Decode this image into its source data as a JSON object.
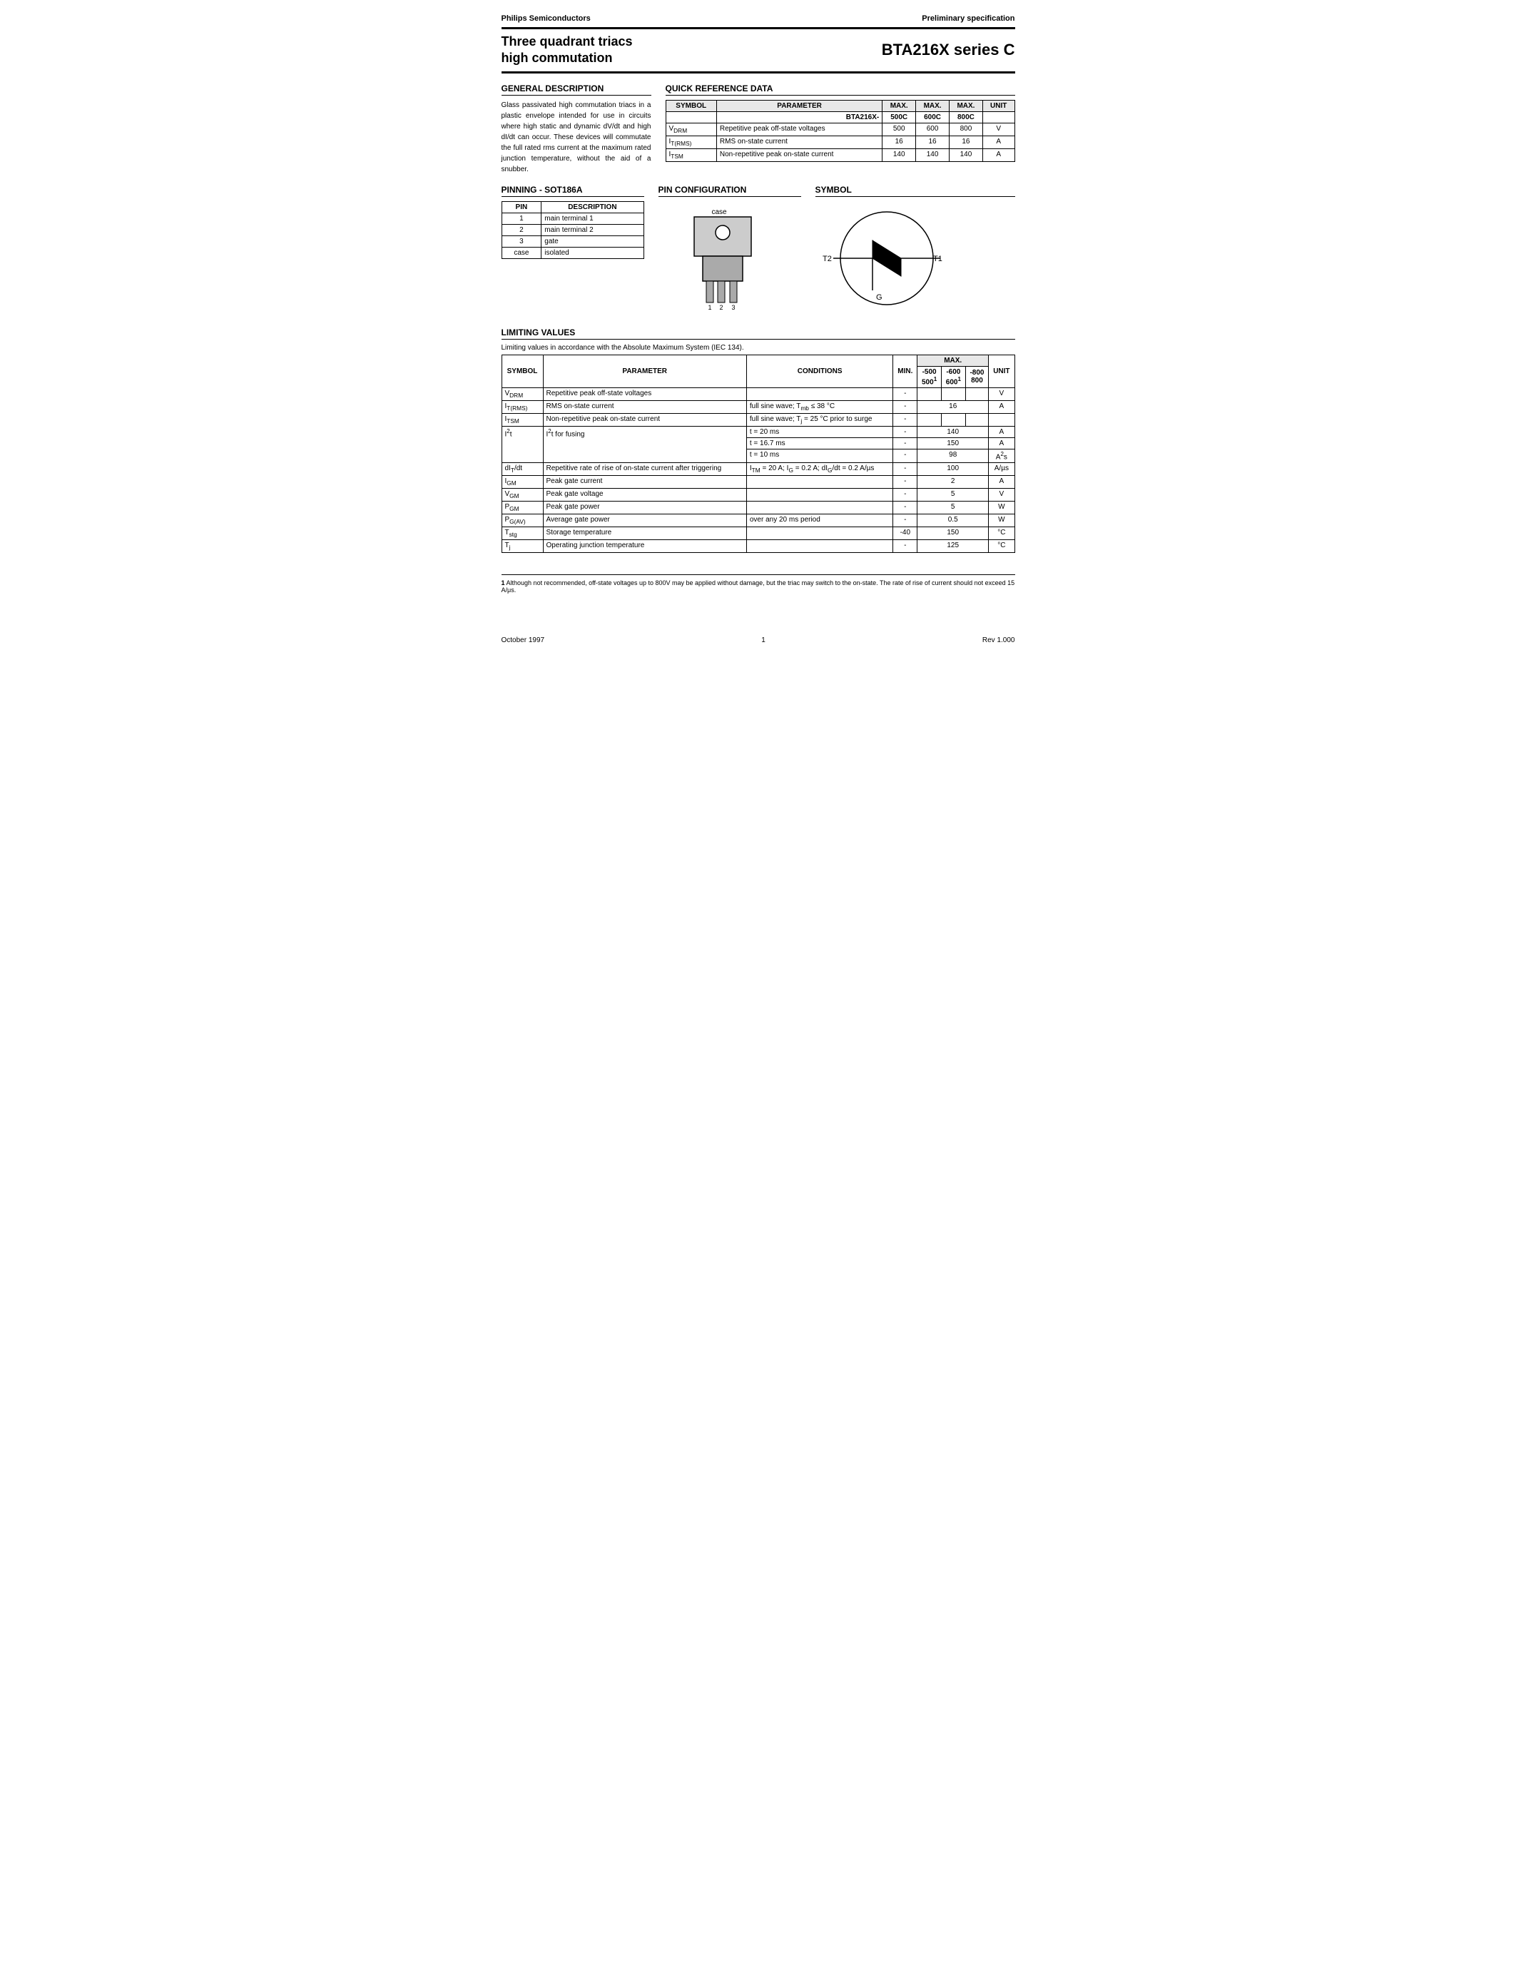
{
  "header": {
    "company": "Philips Semiconductors",
    "spec_type": "Preliminary specification",
    "product_title_line1": "Three quadrant triacs",
    "product_title_line2": "high commutation",
    "part_number": "BTA216X series C"
  },
  "general_description": {
    "title": "GENERAL DESCRIPTION",
    "text": "Glass passivated high commutation triacs in a plastic envelope intended for use in circuits where high static and dynamic dV/dt and high dI/dt can occur. These devices will commutate the full rated rms current at the maximum rated junction temperature, without the aid of a snubber."
  },
  "quick_reference": {
    "title": "QUICK REFERENCE DATA",
    "columns": [
      "SYMBOL",
      "PARAMETER",
      "MAX.",
      "MAX.",
      "MAX.",
      "UNIT"
    ],
    "subheader": [
      "",
      "BTA216X-",
      "500C",
      "600C",
      "800C",
      ""
    ],
    "rows": [
      [
        "V_DRM",
        "Repetitive peak off-state voltages",
        "500",
        "600",
        "800",
        "V"
      ],
      [
        "I_T(RMS)",
        "RMS on-state current",
        "16",
        "16",
        "16",
        "A"
      ],
      [
        "I_TSM",
        "Non-repetitive peak on-state current",
        "140",
        "140",
        "140",
        "A"
      ]
    ]
  },
  "pinning": {
    "title": "PINNING - SOT186A",
    "col_pin": "PIN",
    "col_desc": "DESCRIPTION",
    "rows": [
      {
        "pin": "1",
        "desc": "main terminal 1"
      },
      {
        "pin": "2",
        "desc": "main terminal 2"
      },
      {
        "pin": "3",
        "desc": "gate"
      },
      {
        "pin": "case",
        "desc": "isolated"
      }
    ]
  },
  "pin_configuration": {
    "title": "PIN CONFIGURATION"
  },
  "symbol_section": {
    "title": "SYMBOL"
  },
  "limiting_values": {
    "title": "LIMITING VALUES",
    "note": "Limiting values in accordance with the Absolute Maximum System (IEC 134).",
    "columns": [
      "SYMBOL",
      "PARAMETER",
      "CONDITIONS",
      "MIN.",
      "MAX.",
      "",
      "",
      "UNIT"
    ],
    "subheader_max": [
      "-500",
      "-600",
      "-800"
    ],
    "subheader_max2": [
      "500¹",
      "600¹",
      "800"
    ],
    "rows": [
      {
        "symbol": "V_DRM",
        "parameter": "Repetitive peak off-state voltages",
        "conditions": "",
        "min": "-",
        "max500": "-500\n500¹",
        "max600": "-600\n600¹",
        "max800": "-800\n800",
        "unit": "V"
      },
      {
        "symbol": "I_T(RMS)",
        "parameter": "RMS on-state current",
        "conditions": "full sine wave; T_mb ≤ 38 °C",
        "min": "-",
        "max500": "",
        "max600": "16",
        "max800": "",
        "unit": "A"
      },
      {
        "symbol": "I_TSM",
        "parameter": "Non-repetitive peak on-state current",
        "conditions": "full sine wave; T_j = 25 °C prior to surge",
        "min": "-",
        "max500": "",
        "max600": "",
        "max800": "",
        "unit": ""
      },
      {
        "symbol": "I²t",
        "parameter": "I²t for fusing",
        "conditions_multi": [
          {
            "cond": "t = 20 ms",
            "min": "-",
            "max": "140",
            "unit": "A"
          },
          {
            "cond": "t = 16.7 ms",
            "min": "-",
            "max": "150",
            "unit": "A"
          },
          {
            "cond": "t = 10 ms",
            "min": "-",
            "max": "98",
            "unit": "A²s"
          }
        ]
      },
      {
        "symbol": "dI_T/dt",
        "parameter": "Repetitive rate of rise of on-state current after triggering",
        "conditions": "I_TM = 20 A; I_G = 0.2 A; dI_G/dt = 0.2 A/μs",
        "min": "-",
        "max": "100",
        "unit": "A/μs"
      },
      {
        "symbol": "I_GM",
        "parameter": "Peak gate current",
        "conditions": "",
        "min": "-",
        "max": "2",
        "unit": "A"
      },
      {
        "symbol": "V_GM",
        "parameter": "Peak gate voltage",
        "conditions": "",
        "min": "-",
        "max": "5",
        "unit": "V"
      },
      {
        "symbol": "P_GM",
        "parameter": "Peak gate power",
        "conditions": "",
        "min": "-",
        "max": "5",
        "unit": "W"
      },
      {
        "symbol": "P_G(AV)",
        "parameter": "Average gate power",
        "conditions": "over any 20 ms period",
        "min": "-",
        "max": "0.5",
        "unit": "W"
      },
      {
        "symbol": "T_stg",
        "parameter": "Storage temperature",
        "conditions": "",
        "min": "-40",
        "max": "150",
        "unit": "°C"
      },
      {
        "symbol": "T_j",
        "parameter": "Operating junction temperature",
        "conditions": "",
        "min": "-",
        "max": "125",
        "unit": "°C"
      }
    ]
  },
  "footnote": {
    "number": "1",
    "text": "Although not recommended, off-state voltages up to 800V may be applied without damage, but the triac may switch to the on-state. The rate of rise of current should not exceed 15 A/μs."
  },
  "footer": {
    "date": "October 1997",
    "page": "1",
    "revision": "Rev 1.000"
  }
}
